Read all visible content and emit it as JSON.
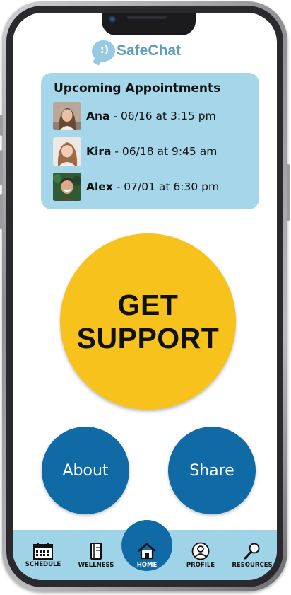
{
  "app": {
    "name": "SafeChat",
    "logo_icon": "chat-bubble-icon",
    "logo_glyph": ":)"
  },
  "appointments": {
    "title": "Upcoming Appointments",
    "items": [
      {
        "name": "Ana",
        "detail": " - 06/16 at 3:15 pm",
        "avatar": "avatar-ana"
      },
      {
        "name": "Kira",
        "detail": " - 06/18 at 9:45 am",
        "avatar": "avatar-kira"
      },
      {
        "name": "Alex",
        "detail": " - 07/01 at 6:30 pm",
        "avatar": "avatar-alex"
      }
    ]
  },
  "support": {
    "line1": "GET",
    "line2": "SUPPORT"
  },
  "actions": {
    "about": "About",
    "share": "Share"
  },
  "tabs": [
    {
      "label": "SCHEDULE",
      "icon": "calendar-icon"
    },
    {
      "label": "WELLNESS",
      "icon": "notebook-icon"
    },
    {
      "label": "HOME",
      "icon": "home-icon",
      "active": true
    },
    {
      "label": "PROFILE",
      "icon": "user-icon"
    },
    {
      "label": "RESOURCES",
      "icon": "search-icon"
    }
  ],
  "colors": {
    "accent": "#0f6aa6",
    "highlight": "#f7c21b",
    "panel": "#a6d6e9",
    "tabbar": "#9fd3e8",
    "brand": "#5d9bbb"
  }
}
